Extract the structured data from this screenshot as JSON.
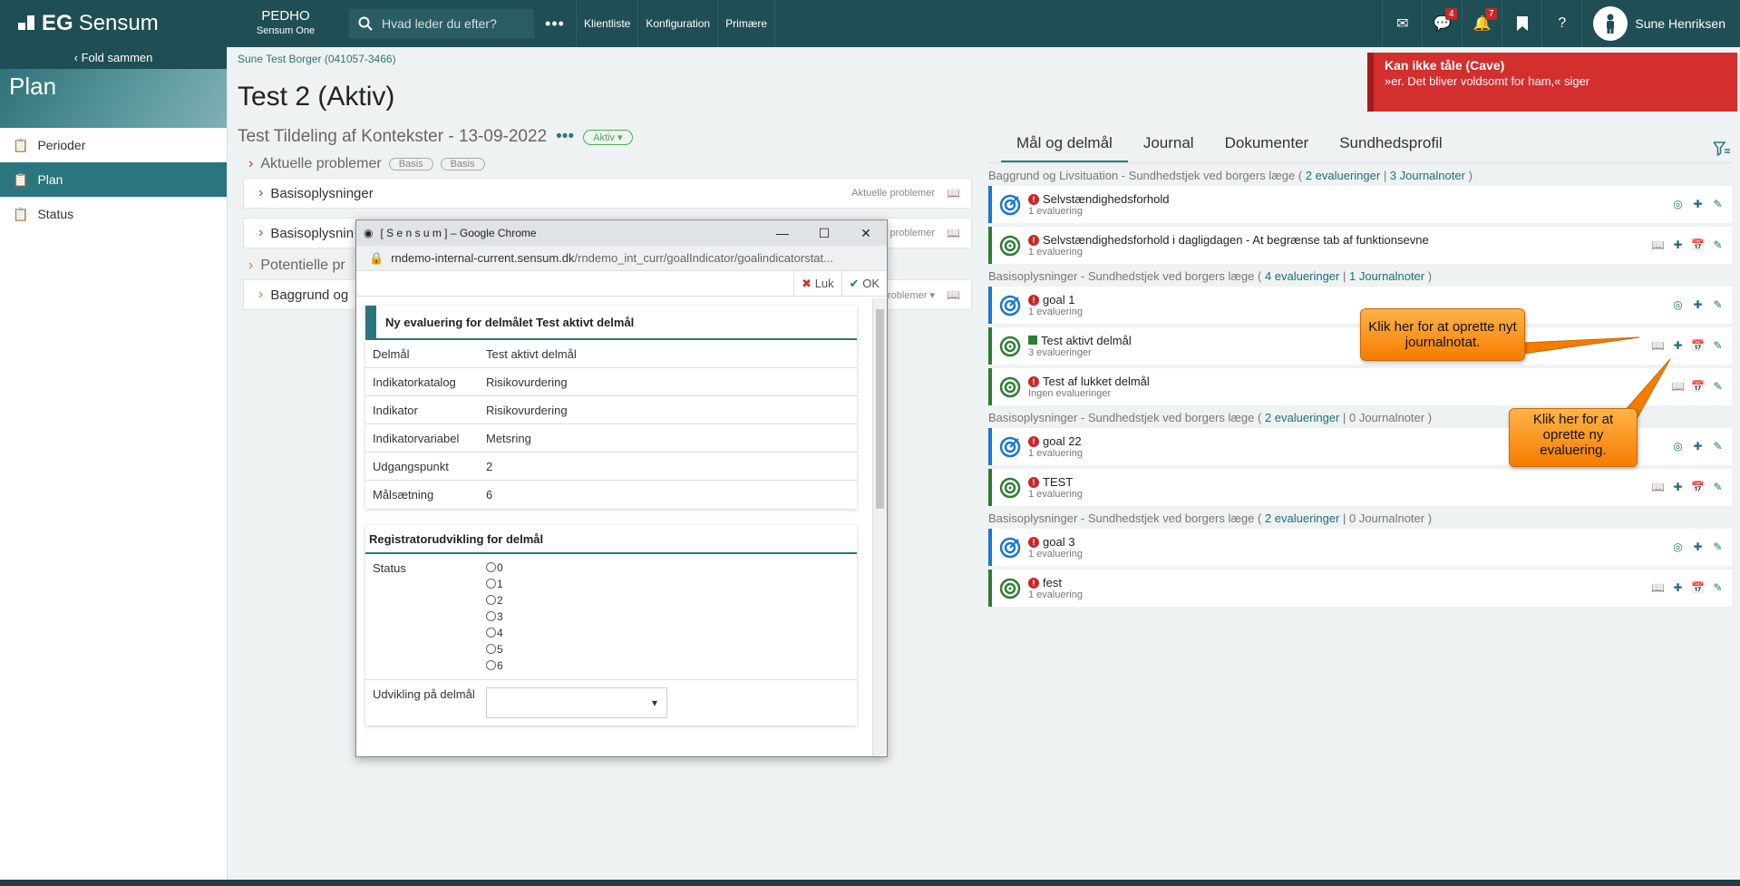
{
  "topbar": {
    "brand_bold": "EG",
    "brand": "Sensum",
    "org_name": "PEDHO",
    "org_sub": "Sensum One",
    "search_placeholder": "Hvad leder du efter?",
    "more": "•••",
    "links": [
      "Klientliste",
      "Konfiguration",
      "Primære"
    ],
    "messages_badge": "4",
    "notifications_badge": "7",
    "help": "?",
    "user_name": "Sune Henriksen"
  },
  "sidebar": {
    "fold": "Fold sammen",
    "banner": "Plan",
    "items": [
      {
        "label": "Perioder"
      },
      {
        "label": "Plan"
      },
      {
        "label": "Status"
      }
    ]
  },
  "breadcrumb": "Sune Test Borger (041057-3466)",
  "page_title": "Test 2 (Aktiv)",
  "cave": {
    "title": "Kan ikke tåle (Cave)",
    "text": "»er. Det bliver voldsomt for ham,« siger"
  },
  "left": {
    "subtitle": "Test Tildeling af Kontekster - 13-09-2022",
    "status_pill": "Aktiv",
    "section1": "Aktuelle problemer",
    "basis": "Basis",
    "card1": "Basisoplysninger",
    "card1_tag": "Aktuelle problemer",
    "card2": "Basisoplysnin",
    "card2_tag": "problemer",
    "section2": "Potentielle pr",
    "card3": "Baggrund og",
    "card3_tag": "roblemer"
  },
  "popup": {
    "window_title": "[ S e n s u m ] – Google Chrome",
    "url_domain": "rndemo-internal-current.sensum.dk",
    "url_path": "/rndemo_int_curr/goalIndicator/goalindicatorstat...",
    "close_label": "Luk",
    "ok_label": "OK",
    "header": "Ny evaluering for delmålet Test aktivt delmål",
    "rows": [
      {
        "label": "Delmål",
        "value": "Test aktivt delmål"
      },
      {
        "label": "Indikatorkatalog",
        "value": "Risikovurdering"
      },
      {
        "label": "Indikator",
        "value": "Risikovurdering"
      },
      {
        "label": "Indikatorvariabel",
        "value": "Metsring"
      },
      {
        "label": "Udgangspunkt",
        "value": "2"
      },
      {
        "label": "Målsætning",
        "value": "6"
      }
    ],
    "reg_header": "Registratorudvikling for delmål",
    "status_label": "Status",
    "status_options": [
      "0",
      "1",
      "2",
      "3",
      "4",
      "5",
      "6"
    ],
    "dev_label": "Udvikling på delmål"
  },
  "right": {
    "tabs": [
      "Mål og delmål",
      "Journal",
      "Dokumenter",
      "Sundhedsprofil"
    ],
    "groups": [
      {
        "title": "Baggrund og Livsituation - Sundhedstjek ved borgers læge (",
        "evals": "2 evalueringer",
        "sep": " |  ",
        "notes": "3 Journalnoter",
        "end": " )",
        "goals": [
          {
            "name": "Selvstændighedsforhold",
            "sub": "1 evaluering"
          },
          {
            "name": "Selvstændighedsforhold i dagligdagen - At begrænse tab af funktionsevne",
            "sub": "1 evaluering"
          }
        ]
      },
      {
        "title": "Basisoplysninger - Sundhedstjek ved borgers læge (",
        "evals": "4 evalueringer",
        "sep": " |  ",
        "notes": "1 Journalnoter",
        "end": " )",
        "goals": [
          {
            "name": "goal 1",
            "sub": "1 evaluering"
          },
          {
            "name": "Test aktivt delmål",
            "sub": "3 evalueringer"
          },
          {
            "name": "Test af lukket delmål",
            "sub": "Ingen evalueringer"
          }
        ]
      },
      {
        "title": "Basisoplysninger - Sundhedstjek ved borgers læge (",
        "evals": "2 evalueringer",
        "sep": " | ",
        "notes": "0 Journalnoter",
        "end": " )",
        "goals": [
          {
            "name": "goal 22",
            "sub": "1 evaluering"
          },
          {
            "name": "TEST",
            "sub": "1 evaluering"
          }
        ]
      },
      {
        "title": "Basisoplysninger - Sundhedstjek ved borgers læge (",
        "evals": "2 evalueringer",
        "sep": " | ",
        "notes": "0 Journalnoter",
        "end": " )",
        "goals": [
          {
            "name": "goal 3",
            "sub": "1 evaluering"
          },
          {
            "name": "fest",
            "sub": "1 evaluering"
          }
        ]
      }
    ]
  },
  "callouts": {
    "journal": "Klik her for at oprette nyt journalnotat.",
    "evaluation": "Klik her for at oprette ny evaluering."
  },
  "colors": {
    "brand": "#1f4e54",
    "accent": "#2a767e",
    "alert": "#d32f2f",
    "callout": "#f57c00"
  }
}
